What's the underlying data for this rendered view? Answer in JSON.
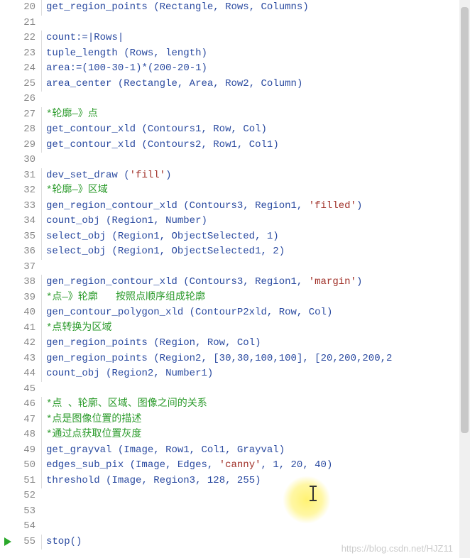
{
  "editor": {
    "watermark": "https://blog.csdn.net/HJZ11",
    "breakpoint_line": 55,
    "cursor_highlight_line": 51,
    "lines": [
      {
        "num": 20,
        "tokens": [
          {
            "t": "fn",
            "v": "get_region_points"
          },
          {
            "t": "plain",
            "v": " ("
          },
          {
            "t": "ident",
            "v": "Rectangle"
          },
          {
            "t": "plain",
            "v": ", "
          },
          {
            "t": "ident",
            "v": "Rows"
          },
          {
            "t": "plain",
            "v": ", "
          },
          {
            "t": "ident",
            "v": "Columns"
          },
          {
            "t": "plain",
            "v": ")"
          }
        ]
      },
      {
        "num": 21,
        "tokens": []
      },
      {
        "num": 22,
        "tokens": [
          {
            "t": "ident",
            "v": "count"
          },
          {
            "t": "plain",
            "v": ":=|"
          },
          {
            "t": "ident",
            "v": "Rows"
          },
          {
            "t": "plain",
            "v": "|"
          }
        ]
      },
      {
        "num": 23,
        "tokens": [
          {
            "t": "fn",
            "v": "tuple_length"
          },
          {
            "t": "plain",
            "v": " ("
          },
          {
            "t": "ident",
            "v": "Rows"
          },
          {
            "t": "plain",
            "v": ", "
          },
          {
            "t": "ident",
            "v": "length"
          },
          {
            "t": "plain",
            "v": ")"
          }
        ]
      },
      {
        "num": 24,
        "tokens": [
          {
            "t": "ident",
            "v": "area"
          },
          {
            "t": "plain",
            "v": ":=("
          },
          {
            "t": "num",
            "v": "100"
          },
          {
            "t": "plain",
            "v": "-"
          },
          {
            "t": "num",
            "v": "30"
          },
          {
            "t": "plain",
            "v": "-"
          },
          {
            "t": "num",
            "v": "1"
          },
          {
            "t": "plain",
            "v": ")*("
          },
          {
            "t": "num",
            "v": "200"
          },
          {
            "t": "plain",
            "v": "-"
          },
          {
            "t": "num",
            "v": "20"
          },
          {
            "t": "plain",
            "v": "-"
          },
          {
            "t": "num",
            "v": "1"
          },
          {
            "t": "plain",
            "v": ")"
          }
        ]
      },
      {
        "num": 25,
        "tokens": [
          {
            "t": "fn",
            "v": "area_center"
          },
          {
            "t": "plain",
            "v": " ("
          },
          {
            "t": "ident",
            "v": "Rectangle"
          },
          {
            "t": "plain",
            "v": ", "
          },
          {
            "t": "ident",
            "v": "Area"
          },
          {
            "t": "plain",
            "v": ", "
          },
          {
            "t": "ident",
            "v": "Row2"
          },
          {
            "t": "plain",
            "v": ", "
          },
          {
            "t": "ident",
            "v": "Column"
          },
          {
            "t": "plain",
            "v": ")"
          }
        ]
      },
      {
        "num": 26,
        "tokens": []
      },
      {
        "num": 27,
        "tokens": [
          {
            "t": "comment",
            "v": "*轮廓—》点"
          }
        ]
      },
      {
        "num": 28,
        "tokens": [
          {
            "t": "fn",
            "v": "get_contour_xld"
          },
          {
            "t": "plain",
            "v": " ("
          },
          {
            "t": "ident",
            "v": "Contours1"
          },
          {
            "t": "plain",
            "v": ", "
          },
          {
            "t": "ident",
            "v": "Row"
          },
          {
            "t": "plain",
            "v": ", "
          },
          {
            "t": "ident",
            "v": "Col"
          },
          {
            "t": "plain",
            "v": ")"
          }
        ]
      },
      {
        "num": 29,
        "tokens": [
          {
            "t": "fn",
            "v": "get_contour_xld"
          },
          {
            "t": "plain",
            "v": " ("
          },
          {
            "t": "ident",
            "v": "Contours2"
          },
          {
            "t": "plain",
            "v": ", "
          },
          {
            "t": "ident",
            "v": "Row1"
          },
          {
            "t": "plain",
            "v": ", "
          },
          {
            "t": "ident",
            "v": "Col1"
          },
          {
            "t": "plain",
            "v": ")"
          }
        ]
      },
      {
        "num": 30,
        "tokens": []
      },
      {
        "num": 31,
        "tokens": [
          {
            "t": "fn",
            "v": "dev_set_draw"
          },
          {
            "t": "plain",
            "v": " ("
          },
          {
            "t": "str",
            "v": "'fill'"
          },
          {
            "t": "plain",
            "v": ")"
          }
        ]
      },
      {
        "num": 32,
        "tokens": [
          {
            "t": "comment",
            "v": "*轮廓—》区域"
          }
        ]
      },
      {
        "num": 33,
        "tokens": [
          {
            "t": "fn",
            "v": "gen_region_contour_xld"
          },
          {
            "t": "plain",
            "v": " ("
          },
          {
            "t": "ident",
            "v": "Contours3"
          },
          {
            "t": "plain",
            "v": ", "
          },
          {
            "t": "ident",
            "v": "Region1"
          },
          {
            "t": "plain",
            "v": ", "
          },
          {
            "t": "str",
            "v": "'filled'"
          },
          {
            "t": "plain",
            "v": ")"
          }
        ]
      },
      {
        "num": 34,
        "tokens": [
          {
            "t": "fn",
            "v": "count_obj"
          },
          {
            "t": "plain",
            "v": " ("
          },
          {
            "t": "ident",
            "v": "Region1"
          },
          {
            "t": "plain",
            "v": ", "
          },
          {
            "t": "ident",
            "v": "Number"
          },
          {
            "t": "plain",
            "v": ")"
          }
        ]
      },
      {
        "num": 35,
        "tokens": [
          {
            "t": "fn",
            "v": "select_obj"
          },
          {
            "t": "plain",
            "v": " ("
          },
          {
            "t": "ident",
            "v": "Region1"
          },
          {
            "t": "plain",
            "v": ", "
          },
          {
            "t": "ident",
            "v": "ObjectSelected"
          },
          {
            "t": "plain",
            "v": ", "
          },
          {
            "t": "num",
            "v": "1"
          },
          {
            "t": "plain",
            "v": ")"
          }
        ]
      },
      {
        "num": 36,
        "tokens": [
          {
            "t": "fn",
            "v": "select_obj"
          },
          {
            "t": "plain",
            "v": " ("
          },
          {
            "t": "ident",
            "v": "Region1"
          },
          {
            "t": "plain",
            "v": ", "
          },
          {
            "t": "ident",
            "v": "ObjectSelected1"
          },
          {
            "t": "plain",
            "v": ", "
          },
          {
            "t": "num",
            "v": "2"
          },
          {
            "t": "plain",
            "v": ")"
          }
        ]
      },
      {
        "num": 37,
        "tokens": []
      },
      {
        "num": 38,
        "tokens": [
          {
            "t": "fn",
            "v": "gen_region_contour_xld"
          },
          {
            "t": "plain",
            "v": " ("
          },
          {
            "t": "ident",
            "v": "Contours3"
          },
          {
            "t": "plain",
            "v": ", "
          },
          {
            "t": "ident",
            "v": "Region1"
          },
          {
            "t": "plain",
            "v": ", "
          },
          {
            "t": "str",
            "v": "'margin'"
          },
          {
            "t": "plain",
            "v": ")"
          }
        ]
      },
      {
        "num": 39,
        "tokens": [
          {
            "t": "comment",
            "v": "*点—》轮廓   按照点顺序组成轮廓"
          }
        ]
      },
      {
        "num": 40,
        "tokens": [
          {
            "t": "fn",
            "v": "gen_contour_polygon_xld"
          },
          {
            "t": "plain",
            "v": " ("
          },
          {
            "t": "ident",
            "v": "ContourP2xld"
          },
          {
            "t": "plain",
            "v": ", "
          },
          {
            "t": "ident",
            "v": "Row"
          },
          {
            "t": "plain",
            "v": ", "
          },
          {
            "t": "ident",
            "v": "Col"
          },
          {
            "t": "plain",
            "v": ")"
          }
        ]
      },
      {
        "num": 41,
        "tokens": [
          {
            "t": "comment",
            "v": "*点转换为区域"
          }
        ]
      },
      {
        "num": 42,
        "tokens": [
          {
            "t": "fn",
            "v": "gen_region_points"
          },
          {
            "t": "plain",
            "v": " ("
          },
          {
            "t": "ident",
            "v": "Region"
          },
          {
            "t": "plain",
            "v": ", "
          },
          {
            "t": "ident",
            "v": "Row"
          },
          {
            "t": "plain",
            "v": ", "
          },
          {
            "t": "ident",
            "v": "Col"
          },
          {
            "t": "plain",
            "v": ")"
          }
        ]
      },
      {
        "num": 43,
        "tokens": [
          {
            "t": "fn",
            "v": "gen_region_points"
          },
          {
            "t": "plain",
            "v": " ("
          },
          {
            "t": "ident",
            "v": "Region2"
          },
          {
            "t": "plain",
            "v": ", ["
          },
          {
            "t": "num",
            "v": "30"
          },
          {
            "t": "plain",
            "v": ","
          },
          {
            "t": "num",
            "v": "30"
          },
          {
            "t": "plain",
            "v": ","
          },
          {
            "t": "num",
            "v": "100"
          },
          {
            "t": "plain",
            "v": ","
          },
          {
            "t": "num",
            "v": "100"
          },
          {
            "t": "plain",
            "v": "], ["
          },
          {
            "t": "num",
            "v": "20"
          },
          {
            "t": "plain",
            "v": ","
          },
          {
            "t": "num",
            "v": "200"
          },
          {
            "t": "plain",
            "v": ","
          },
          {
            "t": "num",
            "v": "200"
          },
          {
            "t": "plain",
            "v": ","
          },
          {
            "t": "num",
            "v": "2"
          }
        ]
      },
      {
        "num": 44,
        "tokens": [
          {
            "t": "fn",
            "v": "count_obj"
          },
          {
            "t": "plain",
            "v": " ("
          },
          {
            "t": "ident",
            "v": "Region2"
          },
          {
            "t": "plain",
            "v": ", "
          },
          {
            "t": "ident",
            "v": "Number1"
          },
          {
            "t": "plain",
            "v": ")"
          }
        ]
      },
      {
        "num": 45,
        "tokens": []
      },
      {
        "num": 46,
        "tokens": [
          {
            "t": "comment",
            "v": "*点 、轮廓、区域、图像之间的关系"
          }
        ]
      },
      {
        "num": 47,
        "tokens": [
          {
            "t": "comment",
            "v": "*点是图像位置的描述"
          }
        ]
      },
      {
        "num": 48,
        "tokens": [
          {
            "t": "comment",
            "v": "*通过点获取位置灰度"
          }
        ]
      },
      {
        "num": 49,
        "tokens": [
          {
            "t": "fn",
            "v": "get_grayval"
          },
          {
            "t": "plain",
            "v": " ("
          },
          {
            "t": "ident",
            "v": "Image"
          },
          {
            "t": "plain",
            "v": ", "
          },
          {
            "t": "ident",
            "v": "Row1"
          },
          {
            "t": "plain",
            "v": ", "
          },
          {
            "t": "ident",
            "v": "Col1"
          },
          {
            "t": "plain",
            "v": ", "
          },
          {
            "t": "ident",
            "v": "Grayval"
          },
          {
            "t": "plain",
            "v": ")"
          }
        ]
      },
      {
        "num": 50,
        "tokens": [
          {
            "t": "fn",
            "v": "edges_sub_pix"
          },
          {
            "t": "plain",
            "v": " ("
          },
          {
            "t": "ident",
            "v": "Image"
          },
          {
            "t": "plain",
            "v": ", "
          },
          {
            "t": "ident",
            "v": "Edges"
          },
          {
            "t": "plain",
            "v": ", "
          },
          {
            "t": "str",
            "v": "'canny'"
          },
          {
            "t": "plain",
            "v": ", "
          },
          {
            "t": "num",
            "v": "1"
          },
          {
            "t": "plain",
            "v": ", "
          },
          {
            "t": "num",
            "v": "20"
          },
          {
            "t": "plain",
            "v": ", "
          },
          {
            "t": "num",
            "v": "40"
          },
          {
            "t": "plain",
            "v": ")"
          }
        ]
      },
      {
        "num": 51,
        "tokens": [
          {
            "t": "fn",
            "v": "threshold"
          },
          {
            "t": "plain",
            "v": " ("
          },
          {
            "t": "ident",
            "v": "Image"
          },
          {
            "t": "plain",
            "v": ", "
          },
          {
            "t": "ident",
            "v": "Region3"
          },
          {
            "t": "plain",
            "v": ", "
          },
          {
            "t": "num",
            "v": "128"
          },
          {
            "t": "plain",
            "v": ", "
          },
          {
            "t": "num",
            "v": "255"
          },
          {
            "t": "plain",
            "v": ")"
          }
        ]
      },
      {
        "num": 52,
        "tokens": []
      },
      {
        "num": 53,
        "tokens": []
      },
      {
        "num": 54,
        "tokens": []
      },
      {
        "num": 55,
        "tokens": [
          {
            "t": "fn",
            "v": "stop"
          },
          {
            "t": "plain",
            "v": "()"
          }
        ]
      }
    ]
  }
}
